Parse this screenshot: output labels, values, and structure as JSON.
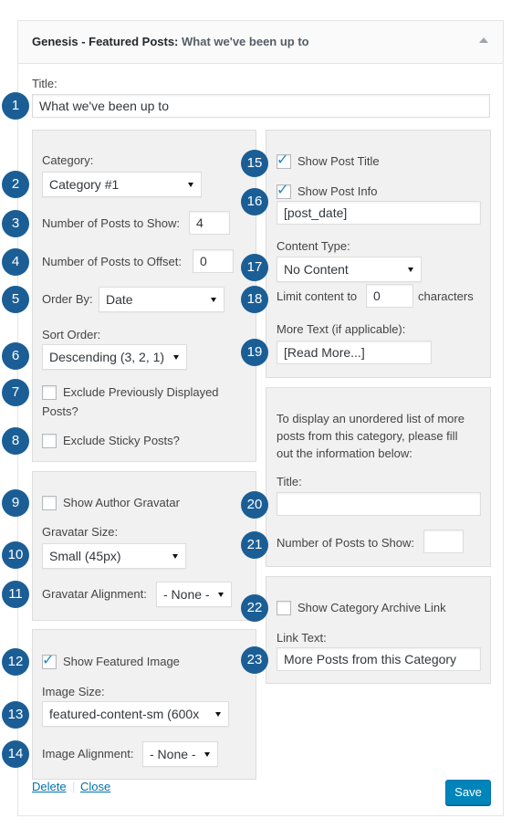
{
  "widget": {
    "title_prefix": "Genesis - Featured Posts:",
    "title_instance": "What we've been up to"
  },
  "title_field": {
    "label": "Title:",
    "value": "What we've been up to"
  },
  "left": {
    "category_label": "Category:",
    "category_value": "Category #1",
    "num_posts_label": "Number of Posts to Show:",
    "num_posts_value": "4",
    "offset_label": "Number of Posts to Offset:",
    "offset_value": "0",
    "order_by_label": "Order By:",
    "order_by_value": "Date",
    "sort_order_label": "Sort Order:",
    "sort_order_value": "Descending (3, 2, 1)",
    "exclude_displayed_label_1": "Exclude Previously Displayed",
    "exclude_displayed_label_2": "Posts?",
    "exclude_displayed_checked": false,
    "exclude_sticky_label": "Exclude Sticky Posts?",
    "exclude_sticky_checked": false,
    "show_gravatar_label": "Show Author Gravatar",
    "show_gravatar_checked": false,
    "gravatar_size_label": "Gravatar Size:",
    "gravatar_size_value": "Small (45px)",
    "gravatar_align_label": "Gravatar Alignment:",
    "gravatar_align_value": "- None -",
    "show_image_label": "Show Featured Image",
    "show_image_checked": true,
    "image_size_label": "Image Size:",
    "image_size_value": "featured-content-sm (600x",
    "image_align_label": "Image Alignment:",
    "image_align_value": "- None -"
  },
  "right": {
    "show_title_label": "Show Post Title",
    "show_title_checked": true,
    "show_info_label": "Show Post Info",
    "show_info_checked": true,
    "post_info_value": "[post_date]",
    "content_type_label": "Content Type:",
    "content_type_value": "No Content",
    "limit_label": "Limit content to",
    "limit_value": "0",
    "limit_suffix": "characters",
    "more_text_label": "More Text (if applicable):",
    "more_text_value": "[Read More...]",
    "extra_desc_1": "To display an unordered list of more",
    "extra_desc_2": "posts from this category, please fill",
    "extra_desc_3": "out the information below:",
    "extra_title_label": "Title:",
    "extra_title_value": "",
    "extra_num_label": "Number of Posts to Show:",
    "extra_num_value": "",
    "archive_link_label": "Show Category Archive Link",
    "archive_link_checked": false,
    "link_text_label": "Link Text:",
    "link_text_value": "More Posts from this Category"
  },
  "actions": {
    "delete_label": "Delete",
    "separator": "|",
    "close_label": "Close",
    "save_label": "Save"
  },
  "badges": [
    "1",
    "2",
    "3",
    "4",
    "5",
    "6",
    "7",
    "8",
    "9",
    "10",
    "11",
    "12",
    "13",
    "14",
    "15",
    "16",
    "17",
    "18",
    "19",
    "20",
    "21",
    "22",
    "23"
  ],
  "colors": {
    "badge": "#1b5e96",
    "link": "#0073aa",
    "primary_button": "#0085ba",
    "panel_bg": "#f1f1f1",
    "check": "#1e8cbe"
  }
}
